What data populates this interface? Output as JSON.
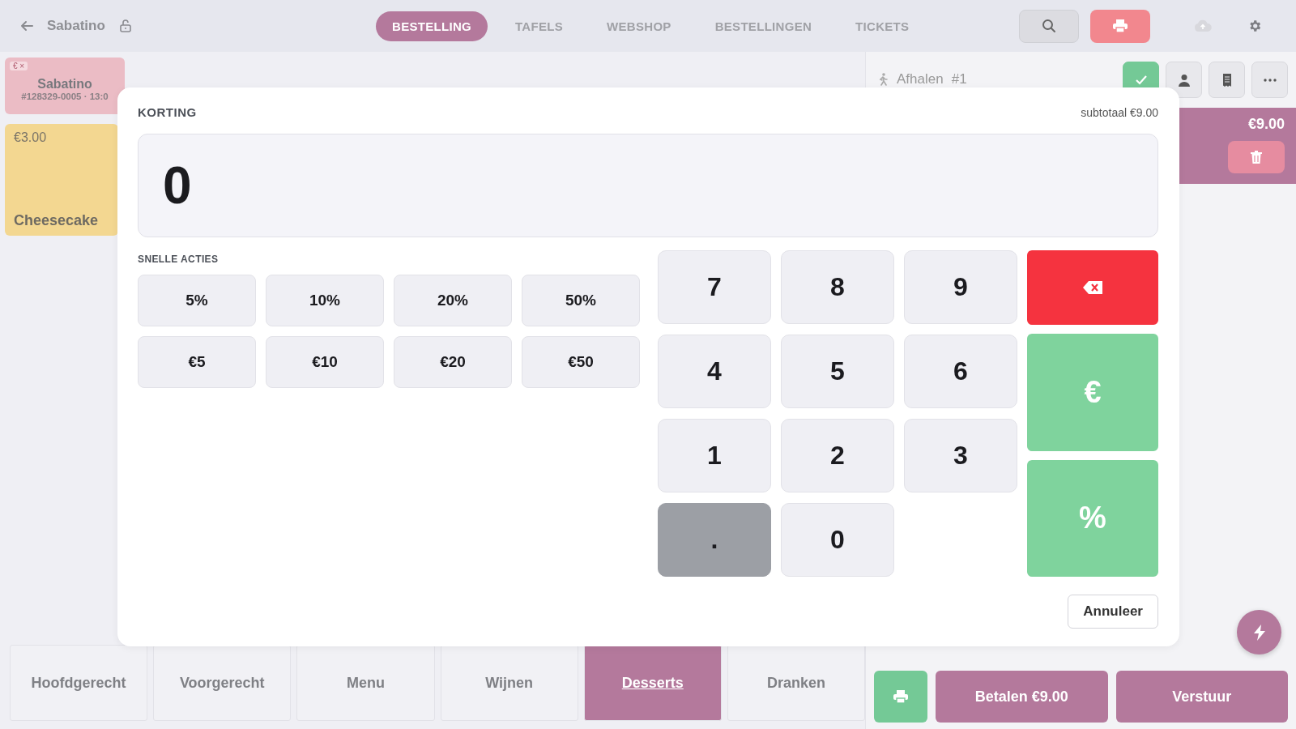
{
  "header": {
    "title": "Sabatino",
    "tabs": [
      {
        "label": "BESTELLING",
        "selected": true
      },
      {
        "label": "TAFELS",
        "selected": false
      },
      {
        "label": "WEBSHOP",
        "selected": false
      },
      {
        "label": "BESTELLINGEN",
        "selected": false
      },
      {
        "label": "TICKETS",
        "selected": false
      }
    ]
  },
  "orders": [
    {
      "badge": "€ ×",
      "name": "Sabatino",
      "meta": "#128329-0005 · 13:0"
    }
  ],
  "products": [
    {
      "price": "€3.00",
      "name": "Cheesecake"
    }
  ],
  "order_panel": {
    "type_label": "Afhalen",
    "number": "#1",
    "line_price": "€9.00"
  },
  "categories": [
    {
      "label": "Hoofdgerecht",
      "selected": false
    },
    {
      "label": "Voorgerecht",
      "selected": false
    },
    {
      "label": "Menu",
      "selected": false
    },
    {
      "label": "Wijnen",
      "selected": false
    },
    {
      "label": "Desserts",
      "selected": true
    },
    {
      "label": "Dranken",
      "selected": false
    }
  ],
  "actions": {
    "pay": "Betalen €9.00",
    "send": "Verstuur"
  },
  "discount_dialog": {
    "title": "KORTING",
    "subtotal": "subtotaal €9.00",
    "value": "0",
    "quick_label": "SNELLE ACTIES",
    "quick_actions": [
      "5%",
      "10%",
      "20%",
      "50%",
      "€5",
      "€10",
      "€20",
      "€50"
    ],
    "keys": [
      {
        "label": "7",
        "kind": "digit"
      },
      {
        "label": "8",
        "kind": "digit"
      },
      {
        "label": "9",
        "kind": "digit"
      },
      {
        "label": "4",
        "kind": "digit"
      },
      {
        "label": "5",
        "kind": "digit"
      },
      {
        "label": "6",
        "kind": "digit"
      },
      {
        "label": "1",
        "kind": "digit"
      },
      {
        "label": "2",
        "kind": "digit"
      },
      {
        "label": "3",
        "kind": "digit"
      },
      {
        "label": ".",
        "kind": "decimal"
      },
      {
        "label": "0",
        "kind": "digit"
      }
    ],
    "modes": [
      "€",
      "%"
    ],
    "cancel": "Annuleer"
  }
}
